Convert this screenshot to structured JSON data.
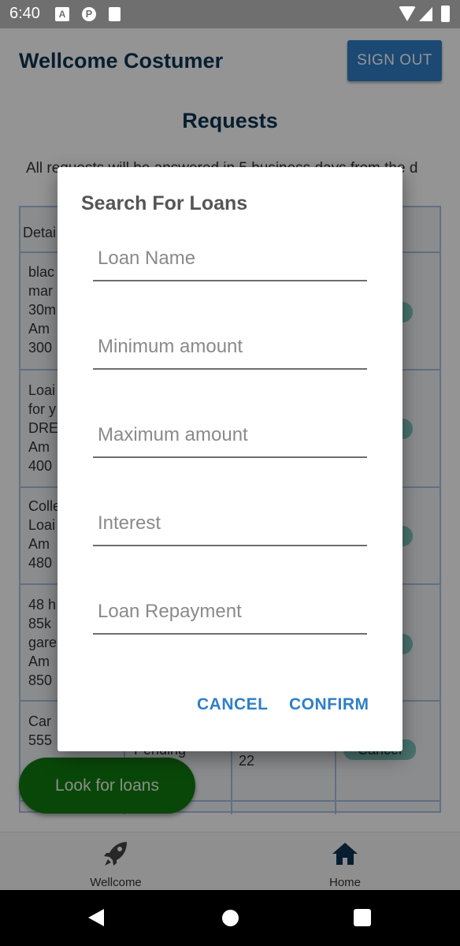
{
  "status_bar": {
    "time": "6:40",
    "icons": [
      "a-notification-icon",
      "p-notification-icon",
      "sd-card-icon",
      "wifi-icon",
      "signal-icon",
      "battery-icon"
    ]
  },
  "header": {
    "title": "Wellcome Costumer",
    "sign_out_label": "SIGN OUT"
  },
  "page": {
    "title": "Requests",
    "notice_visible": "All requests will be answered in 5 business days from the d"
  },
  "table": {
    "header_cell": "Detai",
    "rows": [
      {
        "details": "blac\nmar\n30m\n Am\n300"
      },
      {
        "details": "Loai\nfor y\nDRE\n Am\n400"
      },
      {
        "details": "Colle\nLoai\n Am\n480"
      },
      {
        "details": "48 h\n85k\ngare\n Am\n850"
      },
      {
        "details": "Car\n555\n",
        "status": "Pending",
        "date": "22",
        "action": "Cancel"
      }
    ]
  },
  "fab": {
    "label": "Look for loans"
  },
  "bottom_nav": {
    "items": [
      {
        "label": "Wellcome",
        "icon": "rocket-icon"
      },
      {
        "label": "Home",
        "icon": "home-icon"
      }
    ]
  },
  "dialog": {
    "title": "Search For Loans",
    "fields": [
      {
        "placeholder": "Loan Name",
        "value": ""
      },
      {
        "placeholder": "Minimum amount",
        "value": ""
      },
      {
        "placeholder": "Maximum amount",
        "value": ""
      },
      {
        "placeholder": "Interest",
        "value": ""
      },
      {
        "placeholder": "Loan Repayment",
        "value": ""
      }
    ],
    "cancel_label": "CANCEL",
    "confirm_label": "CONFIRM"
  },
  "colors": {
    "primary_button": "#2f7fc6",
    "title_text": "#0b3552",
    "fab_green": "#117a0f",
    "pill_teal": "#7ec4bd"
  }
}
